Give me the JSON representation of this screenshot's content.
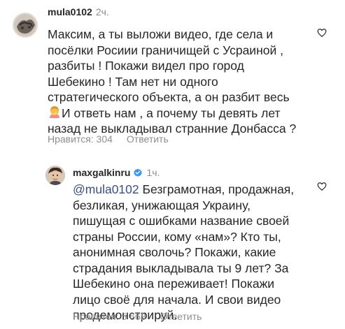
{
  "comments": [
    {
      "username": "mula0102",
      "time": "2ч.",
      "text_lines": [
        "Максим, а ты выложи видео, где села и",
        "посёлки Росиии граничищей с Усраиной ,",
        "разбиты ! Покажи видел про город",
        "Шебекино ! Там нет ни одного",
        "стратегического объекта, а он разбит весь"
      ],
      "text_line_after_emoji": "И ответь нам , а почему ты девять лет",
      "text_lines_end": [
        "назад не выкладывал странние Донбасса ?"
      ],
      "emoji": "woman-facepalming-emoji",
      "likes": "Нравится: 304",
      "reply": "Ответить"
    },
    {
      "username": "maxgalkinru",
      "time": "1ч.",
      "verified": true,
      "mention": "@mula0102",
      "first_line_rest": " Безграмотная, продажная,",
      "text_lines": [
        "безликая, унижающая Украину,",
        "пишущая с ошибками название своей",
        "страны России, кому «нам»? Кто ты,",
        "анонимная сволочь? Покажи, какие",
        "страдания выкладывала ты 9 лет? За",
        "Шебекино она переживает! Покажи",
        "лицо своё для начала. И свои видео",
        "продемонстрируй."
      ],
      "likes": "Нравится: 5 568",
      "reply": "Ответить"
    }
  ],
  "colors": {
    "text": "#262626",
    "secondary": "#8e8e8e",
    "mention": "#385185",
    "verified": "#3897f0"
  }
}
